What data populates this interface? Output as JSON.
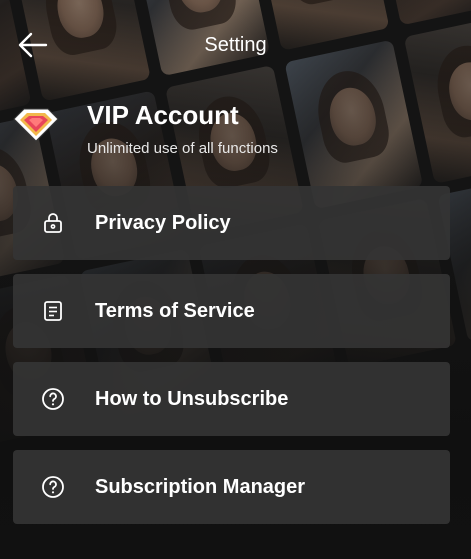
{
  "header": {
    "title": "Setting",
    "back_icon": "arrow-left-icon"
  },
  "vip": {
    "title": "VIP Account",
    "subtitle": "Unlimited use of all functions",
    "icon": "diamond-icon"
  },
  "menu": {
    "items": [
      {
        "label": "Privacy Policy",
        "icon": "lock-icon"
      },
      {
        "label": "Terms of Service",
        "icon": "document-icon"
      },
      {
        "label": "How to Unsubscribe",
        "icon": "help-circle-icon"
      },
      {
        "label": "Subscription Manager",
        "icon": "help-circle-icon"
      }
    ]
  },
  "colors": {
    "item_background": "#343434",
    "text": "#ffffff",
    "diamond_accent": "#e8455a"
  }
}
